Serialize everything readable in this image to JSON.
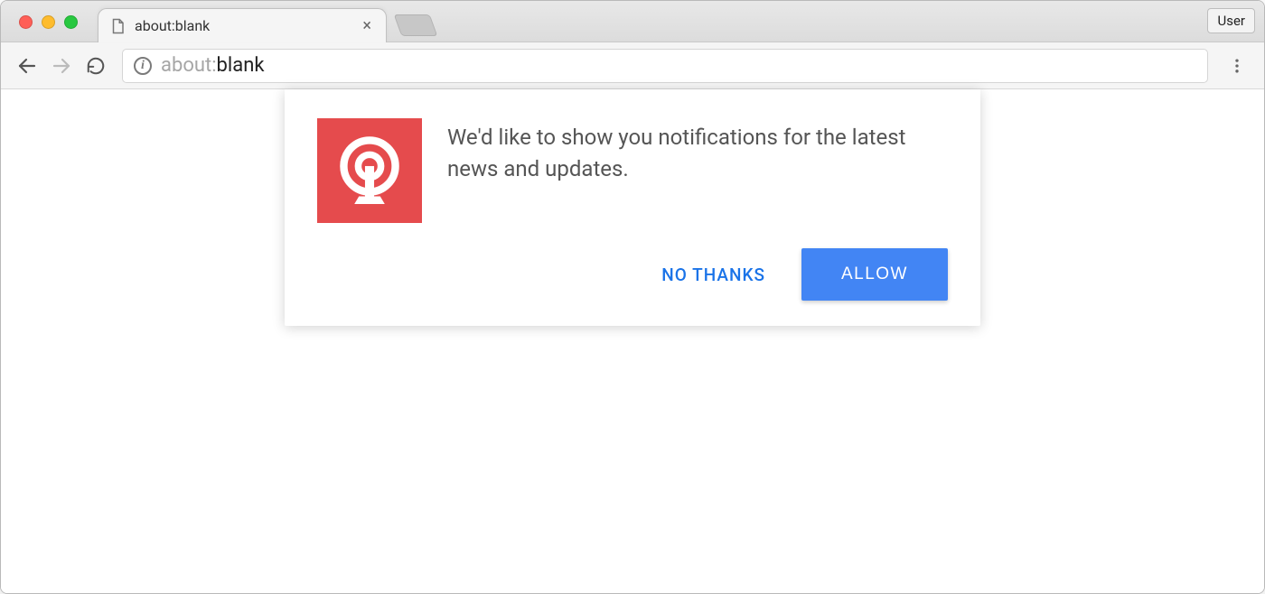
{
  "browser": {
    "tab": {
      "title": "about:blank"
    },
    "toolbar": {
      "url_prefix": "about:",
      "url_path": "blank",
      "user_button": "User"
    }
  },
  "slidedown": {
    "message": "We'd like to show you notifications for the latest news and updates.",
    "icon_name": "onesignal-bell",
    "actions": {
      "no_thanks": "NO THANKS",
      "allow": "ALLOW"
    }
  },
  "colors": {
    "accent_red": "#e54b4d",
    "accent_blue": "#4285f4",
    "link_blue": "#1a73e8"
  }
}
